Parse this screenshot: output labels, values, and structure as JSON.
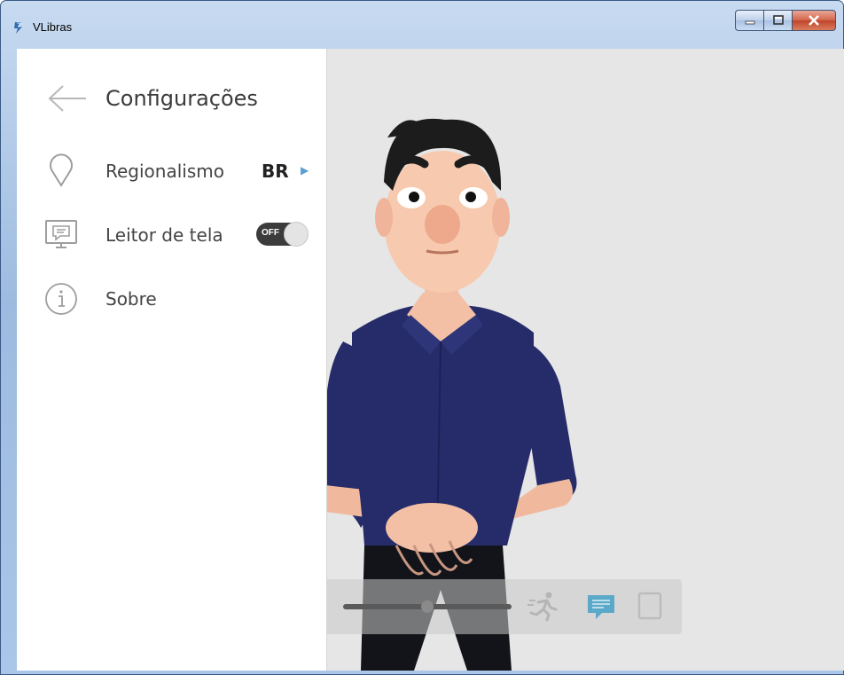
{
  "window": {
    "title": "VLibras",
    "colors": {
      "title_gradient_top": "#c7daf0",
      "close_button": "#c0442a"
    }
  },
  "settings_panel": {
    "title": "Configurações",
    "items": [
      {
        "icon": "location-pin-icon",
        "label": "Regionalismo",
        "value": "BR"
      },
      {
        "icon": "monitor-icon",
        "label": "Leitor de tela",
        "toggle_state": "OFF"
      },
      {
        "icon": "info-icon",
        "label": "Sobre"
      }
    ]
  },
  "player_controls": {
    "speed_slider_level": 0.5,
    "icons": [
      "speed-slider",
      "running-man-icon",
      "subtitle-icon",
      "dictionary-icon"
    ],
    "colors": {
      "subtitle_active": "#5aa9c9"
    }
  },
  "avatar": {
    "shirt_color": "#262c6a",
    "skin_color": "#f3c0a5"
  }
}
